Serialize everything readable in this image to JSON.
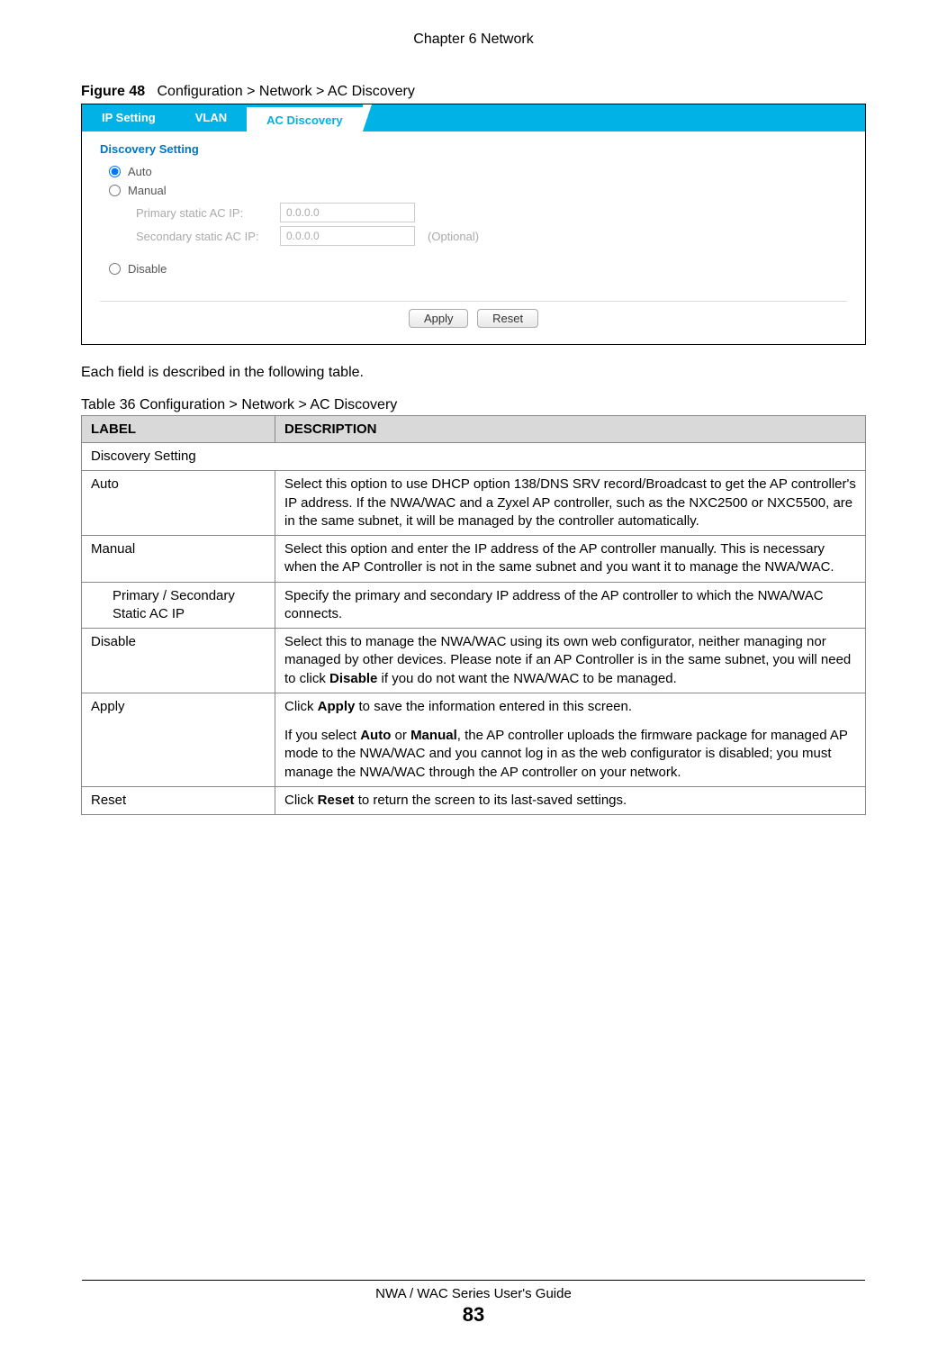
{
  "header": {
    "chapter": "Chapter 6 Network"
  },
  "figure": {
    "label": "Figure 48",
    "caption": "Configuration > Network > AC Discovery"
  },
  "screenshot": {
    "tabs": {
      "ip_setting": "IP Setting",
      "vlan": "VLAN",
      "ac_discovery": "AC Discovery"
    },
    "section_title": "Discovery Setting",
    "options": {
      "auto": "Auto",
      "manual": "Manual",
      "disable": "Disable"
    },
    "fields": {
      "primary_label": "Primary static AC IP:",
      "primary_value": "0.0.0.0",
      "secondary_label": "Secondary static AC IP:",
      "secondary_value": "0.0.0.0",
      "optional": "(Optional)"
    },
    "buttons": {
      "apply": "Apply",
      "reset": "Reset"
    }
  },
  "intro": "Each field is described in the following table.",
  "table": {
    "caption": "Table 36   Configuration > Network > AC Discovery",
    "headers": {
      "label": "LABEL",
      "description": "DESCRIPTION"
    },
    "rows": {
      "discovery_setting": "Discovery Setting",
      "auto": {
        "label": "Auto",
        "desc": "Select this option to use DHCP option 138/DNS SRV record/Broadcast to get the AP controller's IP address. If the NWA/WAC and a Zyxel AP controller, such as the NXC2500 or NXC5500, are in the same subnet, it will be managed by the controller automatically."
      },
      "manual": {
        "label": "Manual",
        "desc": "Select this option and enter the IP address of the AP controller manually. This is necessary when the AP Controller is not in the same subnet and you want it to manage the NWA/WAC."
      },
      "primary_secondary": {
        "label": "Primary / Secondary Static AC IP",
        "desc": "Specify the primary and secondary IP address of the AP controller to which the NWA/WAC connects."
      },
      "disable": {
        "label": "Disable",
        "desc_pre": "Select this to manage the NWA/WAC using its own web configurator, neither managing nor managed by other devices. Please note if an AP Controller is in the same subnet, you will need to click ",
        "desc_bold": "Disable",
        "desc_post": " if you do not want the NWA/WAC to be managed."
      },
      "apply": {
        "label": "Apply",
        "p1_pre": "Click ",
        "p1_bold": "Apply",
        "p1_post": " to save the information entered in this screen.",
        "p2_pre": "If you select ",
        "p2_bold1": "Auto",
        "p2_mid": " or ",
        "p2_bold2": "Manual",
        "p2_post": ", the AP controller uploads the firmware package for managed AP mode to the NWA/WAC and you cannot log in as the web configurator is disabled; you must manage the NWA/WAC through the AP controller on your network."
      },
      "reset": {
        "label": "Reset",
        "desc_pre": "Click ",
        "desc_bold": "Reset",
        "desc_post": " to return the screen to its last-saved settings."
      }
    }
  },
  "footer": {
    "title": "NWA / WAC Series User's Guide",
    "page": "83"
  }
}
